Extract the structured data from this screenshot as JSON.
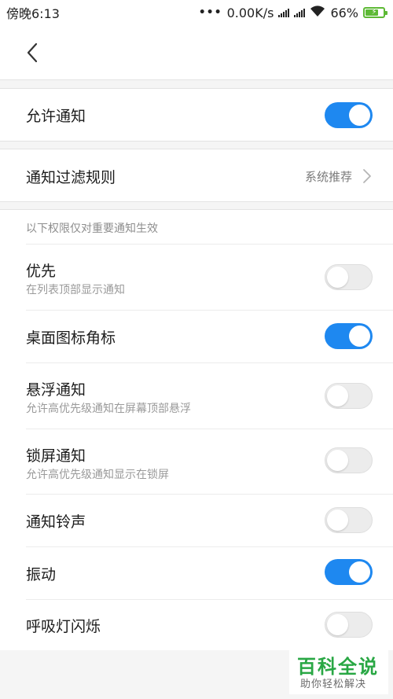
{
  "status_bar": {
    "time": "傍晚6:13",
    "dots": "•••",
    "network_speed": "0.00K/s",
    "battery_percent": "66%",
    "icons": [
      "signal-icon",
      "signal-icon",
      "wifi-icon",
      "battery-charging-icon"
    ]
  },
  "header": {
    "back_icon": "chevron-left-icon"
  },
  "allow_notifications": {
    "label": "允许通知",
    "enabled": true
  },
  "filter_rules": {
    "label": "通知过滤规则",
    "value": "系统推荐"
  },
  "important_hint": "以下权限仅对重要通知生效",
  "settings": [
    {
      "label": "优先",
      "sub": "在列表顶部显示通知",
      "enabled": false
    },
    {
      "label": "桌面图标角标",
      "sub": "",
      "enabled": true
    },
    {
      "label": "悬浮通知",
      "sub": "允许高优先级通知在屏幕顶部悬浮",
      "enabled": false
    },
    {
      "label": "锁屏通知",
      "sub": "允许高优先级通知显示在锁屏",
      "enabled": false
    },
    {
      "label": "通知铃声",
      "sub": "",
      "enabled": false
    },
    {
      "label": "振动",
      "sub": "",
      "enabled": true
    },
    {
      "label": "呼吸灯闪烁",
      "sub": "",
      "enabled": false
    }
  ],
  "watermark": {
    "title": "百科全说",
    "subtitle": "助你轻松解决"
  },
  "colors": {
    "accent": "#1e88f0",
    "battery": "#5db935",
    "watermark": "#29a744"
  }
}
